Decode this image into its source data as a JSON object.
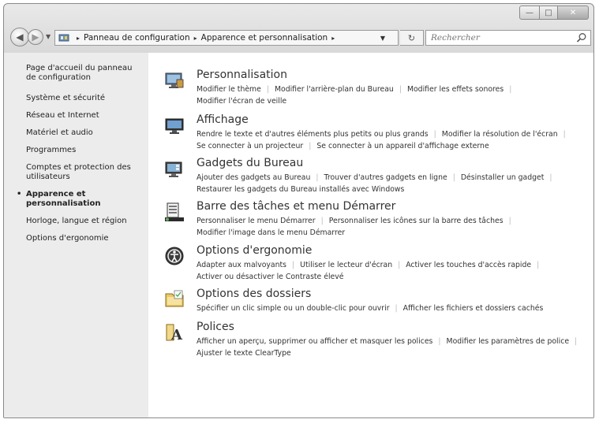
{
  "address": {
    "crumbs": [
      "Panneau de configuration",
      "Apparence et personnalisation"
    ],
    "separator": "▸"
  },
  "search": {
    "placeholder": "Rechercher"
  },
  "sidebar": {
    "items": [
      "Page d'accueil du panneau de configuration",
      "Système et sécurité",
      "Réseau et Internet",
      "Matériel et audio",
      "Programmes",
      "Comptes et protection des utilisateurs",
      "Apparence et personnalisation",
      "Horloge, langue et région",
      "Options d'ergonomie"
    ],
    "current_index": 6
  },
  "categories": [
    {
      "title": "Personnalisation",
      "icon": "personalization-icon",
      "lines": [
        [
          "Modifier le thème",
          "Modifier l'arrière-plan du Bureau",
          "Modifier les effets sonores"
        ],
        [
          "Modifier l'écran de veille"
        ]
      ]
    },
    {
      "title": "Affichage",
      "icon": "display-icon",
      "lines": [
        [
          "Rendre le texte et d'autres éléments plus petits ou plus grands",
          "Modifier la résolution de l'écran"
        ],
        [
          "Se connecter à un projecteur",
          "Se connecter à un appareil d'affichage externe"
        ]
      ]
    },
    {
      "title": "Gadgets du Bureau",
      "icon": "desktop-gadgets-icon",
      "lines": [
        [
          "Ajouter des gadgets au Bureau",
          "Trouver d'autres gadgets en ligne",
          "Désinstaller un gadget"
        ],
        [
          "Restaurer les gadgets du Bureau installés avec Windows"
        ]
      ]
    },
    {
      "title": "Barre des tâches et menu Démarrer",
      "icon": "taskbar-icon",
      "lines": [
        [
          "Personnaliser le menu Démarrer",
          "Personnaliser les icônes sur la barre des tâches"
        ],
        [
          "Modifier l'image dans le menu Démarrer"
        ]
      ]
    },
    {
      "title": "Options d'ergonomie",
      "icon": "ease-of-access-icon",
      "lines": [
        [
          "Adapter aux malvoyants",
          "Utiliser le lecteur d'écran",
          "Activer les touches d'accès rapide"
        ],
        [
          "Activer ou désactiver le Contraste élevé"
        ]
      ]
    },
    {
      "title": "Options des dossiers",
      "icon": "folder-options-icon",
      "lines": [
        [
          "Spécifier un clic simple ou un double-clic pour ouvrir",
          "Afficher les fichiers et dossiers cachés"
        ]
      ]
    },
    {
      "title": "Polices",
      "icon": "fonts-icon",
      "lines": [
        [
          "Afficher un aperçu, supprimer ou afficher et masquer les polices",
          "Modifier les paramètres de police"
        ],
        [
          "Ajuster le texte ClearType"
        ]
      ]
    }
  ]
}
